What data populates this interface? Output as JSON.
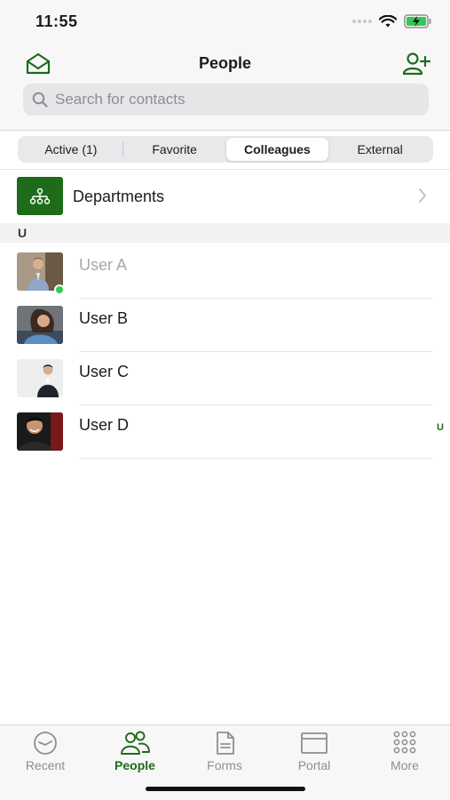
{
  "status_bar": {
    "time": "11:55"
  },
  "header": {
    "title": "People",
    "search_placeholder": "Search for contacts"
  },
  "segments": [
    {
      "label": "Active (1)",
      "active": false
    },
    {
      "label": "Favorite",
      "active": false
    },
    {
      "label": "Colleagues",
      "active": true
    },
    {
      "label": "External",
      "active": false
    }
  ],
  "departments": {
    "label": "Departments"
  },
  "section": {
    "letter": "U"
  },
  "contacts": [
    {
      "name": "User A",
      "online": true,
      "dimmed": true
    },
    {
      "name": "User B",
      "online": false,
      "dimmed": false
    },
    {
      "name": "User C",
      "online": false,
      "dimmed": false
    },
    {
      "name": "User D",
      "online": false,
      "dimmed": false
    }
  ],
  "index_bar": {
    "letter": "U"
  },
  "tabs": [
    {
      "label": "Recent",
      "icon": "clock-icon",
      "active": false
    },
    {
      "label": "People",
      "icon": "people-icon",
      "active": true
    },
    {
      "label": "Forms",
      "icon": "document-icon",
      "active": false
    },
    {
      "label": "Portal",
      "icon": "window-icon",
      "active": false
    },
    {
      "label": "More",
      "icon": "grid-icon",
      "active": false
    }
  ],
  "colors": {
    "accent": "#1e6b1a",
    "online": "#34c759"
  }
}
